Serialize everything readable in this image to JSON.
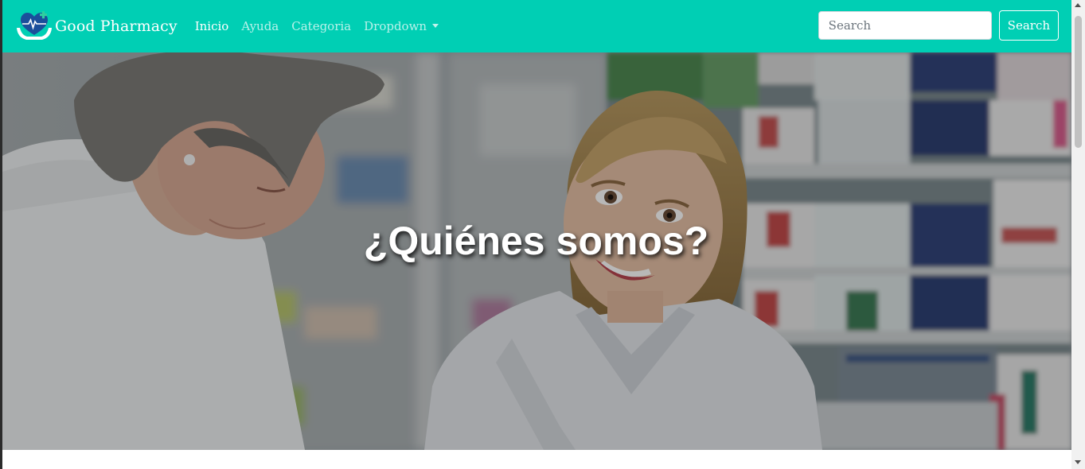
{
  "navbar": {
    "brand_name": "Good Pharmacy",
    "links": [
      {
        "label": "Inicio"
      },
      {
        "label": "Ayuda"
      },
      {
        "label": "Categoria"
      },
      {
        "label": "Dropdown"
      }
    ],
    "search_placeholder": "Search",
    "search_value": "",
    "search_button_label": "Search",
    "background_color": "#00cfb4"
  },
  "hero": {
    "title": "¿Quiénes somos?"
  },
  "icons": {
    "brand_logo": "heart-cross-hands-icon",
    "dropdown_caret": "caret-down-icon",
    "scroll_up": "arrow-up-icon",
    "scroll_down": "arrow-down-icon"
  }
}
